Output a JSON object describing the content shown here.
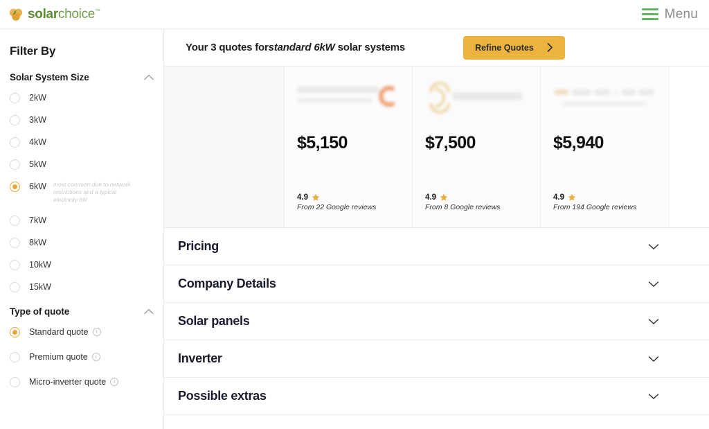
{
  "brand": {
    "name_bold": "solar",
    "name_light": "choice",
    "trademark": "™",
    "logo_icon": "solar-choice-leaf-logo",
    "green_dark": "#5a8b33",
    "green_light": "#6f9c4a",
    "logo_amber": "#e3a83c"
  },
  "topbar": {
    "menu_label": "Menu",
    "menu_icon": "hamburger-icon",
    "menu_icon_color": "#5fb564"
  },
  "sidebar": {
    "title": "Filter By",
    "sections": [
      {
        "heading": "Solar System Size",
        "collapse_icon": "chevron-up-icon",
        "options": [
          {
            "label": "2kW",
            "selected": false,
            "note": ""
          },
          {
            "label": "3kW",
            "selected": false,
            "note": ""
          },
          {
            "label": "4kW",
            "selected": false,
            "note": ""
          },
          {
            "label": "5kW",
            "selected": false,
            "note": ""
          },
          {
            "label": "6kW",
            "selected": true,
            "note": "most common due to network restrictions and a typical electricity bill"
          },
          {
            "label": "7kW",
            "selected": false,
            "note": ""
          },
          {
            "label": "8kW",
            "selected": false,
            "note": ""
          },
          {
            "label": "10kW",
            "selected": false,
            "note": ""
          },
          {
            "label": "15kW",
            "selected": false,
            "note": ""
          }
        ]
      },
      {
        "heading": "Type of quote",
        "collapse_icon": "chevron-up-icon",
        "options": [
          {
            "label": "Standard quote",
            "selected": true,
            "info": "i"
          },
          {
            "label": "Premium quote",
            "selected": false,
            "info": "i"
          },
          {
            "label": "Micro-inverter quote",
            "selected": false,
            "info": "i"
          }
        ]
      }
    ]
  },
  "main": {
    "header": {
      "title_prefix": "Your 3 quotes for",
      "title_emphasis": "standard 6kW",
      "title_suffix": " solar systems",
      "refine_button": {
        "label": "Refine Quotes",
        "icon": "chevron-right-icon",
        "color": "#edb33f"
      }
    },
    "quotes": [
      {
        "installer_logo": "blurred-installer-logo-1",
        "price": "$5,150",
        "rating": "4.9",
        "star_icon": "star-icon",
        "reviews": "From 22 Google reviews"
      },
      {
        "installer_logo": "blurred-installer-logo-2",
        "price": "$7,500",
        "rating": "4.9",
        "star_icon": "star-icon",
        "reviews": "From 8 Google reviews"
      },
      {
        "installer_logo": "blurred-installer-logo-3",
        "price": "$5,940",
        "rating": "4.9",
        "star_icon": "star-icon",
        "reviews": "From 194 Google reviews"
      }
    ],
    "accordions": [
      {
        "label": "Pricing",
        "icon": "chevron-down-icon"
      },
      {
        "label": "Company Details",
        "icon": "chevron-down-icon"
      },
      {
        "label": "Solar panels",
        "icon": "chevron-down-icon"
      },
      {
        "label": "Inverter",
        "icon": "chevron-down-icon"
      },
      {
        "label": "Possible extras",
        "icon": "chevron-down-icon"
      }
    ]
  }
}
